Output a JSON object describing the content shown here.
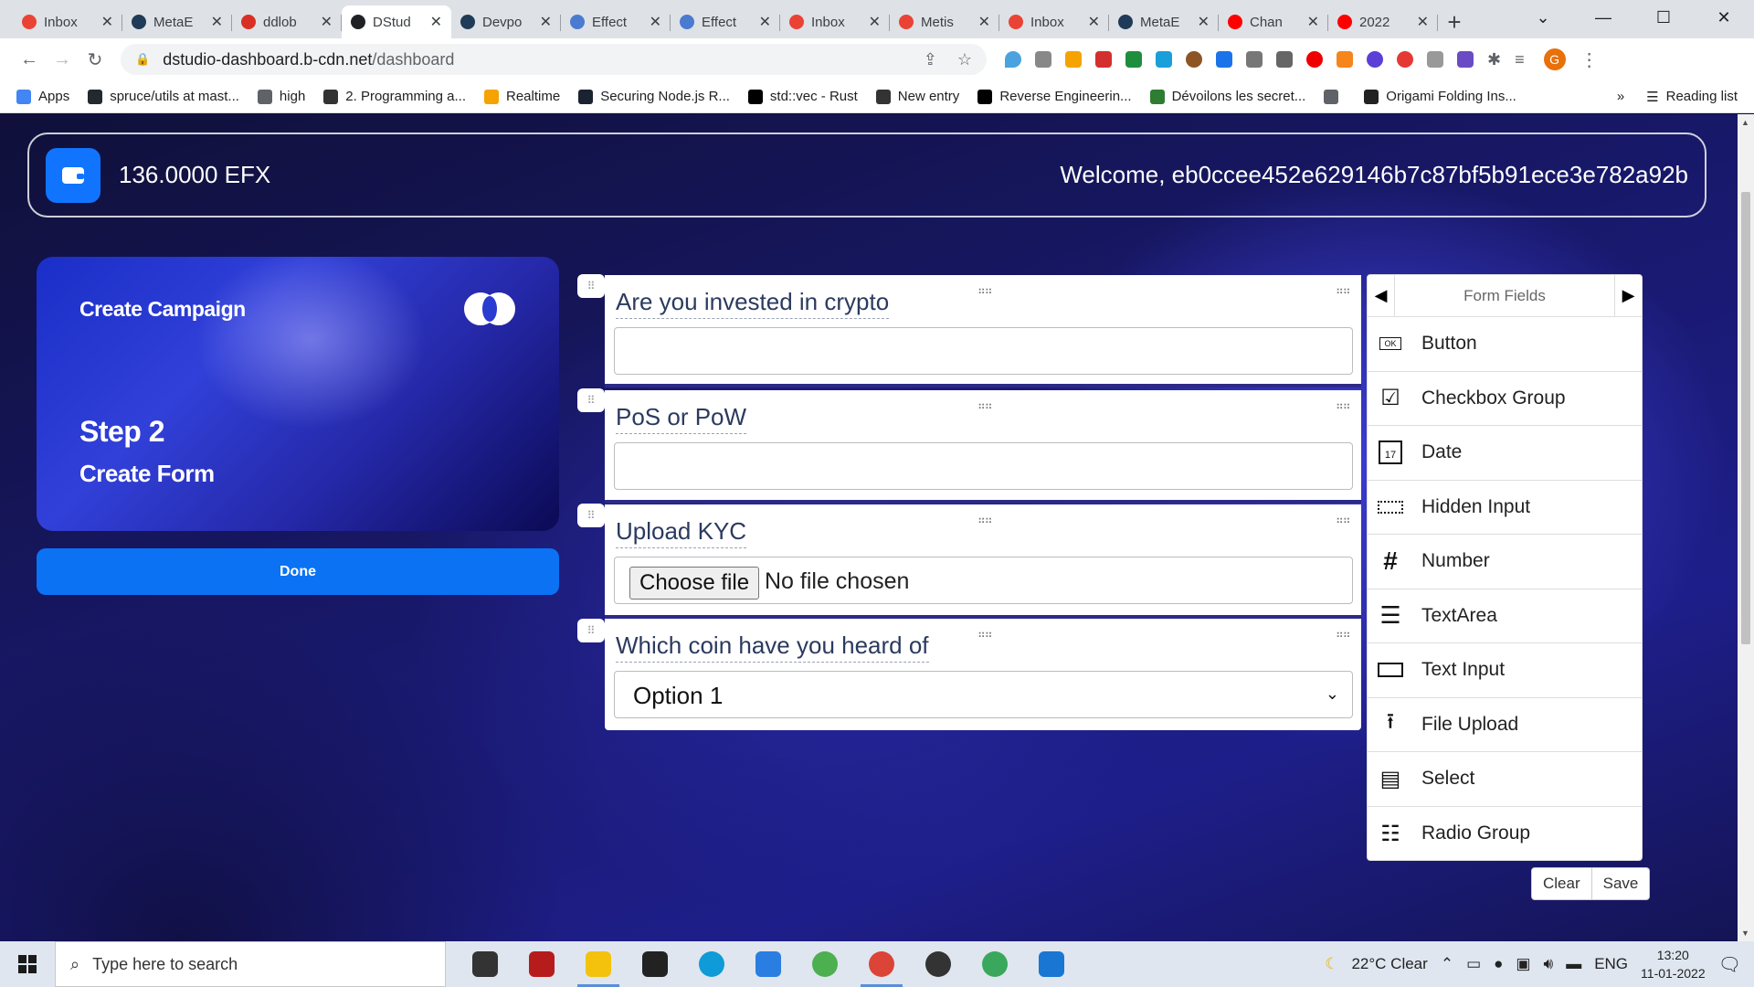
{
  "browser": {
    "tabs": [
      {
        "title": "Inbox",
        "icon": "gmail-icon",
        "color": "#ea4335"
      },
      {
        "title": "MetaE",
        "icon": "d-icon",
        "color": "#1f3b57"
      },
      {
        "title": "ddlob",
        "icon": "badge-750-icon",
        "color": "#d93025"
      },
      {
        "title": "DStud",
        "icon": "s-icon",
        "color": "#202124",
        "active": true
      },
      {
        "title": "Devpo",
        "icon": "d-icon",
        "color": "#1f3b57"
      },
      {
        "title": "Effect",
        "icon": "search-globe-icon",
        "color": "#4a7bd0"
      },
      {
        "title": "Effect",
        "icon": "search-globe-icon",
        "color": "#4a7bd0"
      },
      {
        "title": "Inbox",
        "icon": "gmail-icon",
        "color": "#ea4335"
      },
      {
        "title": "Metis",
        "icon": "gmail-icon",
        "color": "#ea4335"
      },
      {
        "title": "Inbox",
        "icon": "gmail-icon",
        "color": "#ea4335"
      },
      {
        "title": "MetaE",
        "icon": "d-icon",
        "color": "#1f3b57"
      },
      {
        "title": "Chan",
        "icon": "youtube-icon",
        "color": "#ff0000"
      },
      {
        "title": "2022",
        "icon": "youtube-icon",
        "color": "#ff0000"
      }
    ],
    "url_domain": "dstudio-dashboard.b-cdn.net",
    "url_path": "/dashboard",
    "profile_initial": "G",
    "bookmarks": [
      {
        "label": "Apps",
        "color": "#4285f4"
      },
      {
        "label": "spruce/utils at mast...",
        "color": "#24292e"
      },
      {
        "label": "high",
        "color": "#5f6368"
      },
      {
        "label": "2. Programming a...",
        "color": "#333333"
      },
      {
        "label": "Realtime",
        "color": "#f4a300"
      },
      {
        "label": "Securing Node.js R...",
        "color": "#1b2330"
      },
      {
        "label": "std::vec - Rust",
        "color": "#000000"
      },
      {
        "label": "New entry",
        "color": "#333333"
      },
      {
        "label": "Reverse Engineerin...",
        "color": "#000000"
      },
      {
        "label": "Dévoilons les secret...",
        "color": "#2e7d32"
      },
      {
        "label": "",
        "color": "#5f6368"
      },
      {
        "label": "Origami Folding Ins...",
        "color": "#222222"
      }
    ],
    "reading_list": "Reading list",
    "more": "»"
  },
  "header": {
    "balance": "136.0000 EFX",
    "welcome": "Welcome, eb0ccee452e629146b7c87bf5b91ece3e782a92b"
  },
  "campaign": {
    "title": "Create Campaign",
    "step": "Step 2",
    "subtitle": "Create Form",
    "done_label": "Done"
  },
  "form": {
    "fields": [
      {
        "label": "Are you invested in crypto",
        "type": "text"
      },
      {
        "label": "PoS or PoW",
        "type": "text"
      },
      {
        "label": "Upload KYC",
        "type": "file",
        "button": "Choose file",
        "status": "No file chosen"
      },
      {
        "label": "Which coin have you heard of",
        "type": "select",
        "value": "Option 1"
      }
    ]
  },
  "panel": {
    "title": "Form Fields",
    "items": [
      {
        "label": "Button",
        "icon": "ok-button-icon"
      },
      {
        "label": "Checkbox Group",
        "icon": "checkbox-icon"
      },
      {
        "label": "Date",
        "icon": "calendar-icon"
      },
      {
        "label": "Hidden Input",
        "icon": "dotted-input-icon"
      },
      {
        "label": "Number",
        "icon": "hash-icon"
      },
      {
        "label": "TextArea",
        "icon": "textarea-icon"
      },
      {
        "label": "Text Input",
        "icon": "text-input-icon"
      },
      {
        "label": "File Upload",
        "icon": "upload-icon"
      },
      {
        "label": "Select",
        "icon": "select-icon"
      },
      {
        "label": "Radio Group",
        "icon": "radio-list-icon"
      }
    ],
    "clear_label": "Clear",
    "save_label": "Save"
  },
  "taskbar": {
    "search_placeholder": "Type here to search",
    "weather": "22°C  Clear",
    "lang": "ENG",
    "time": "13:20",
    "date": "11-01-2022"
  }
}
